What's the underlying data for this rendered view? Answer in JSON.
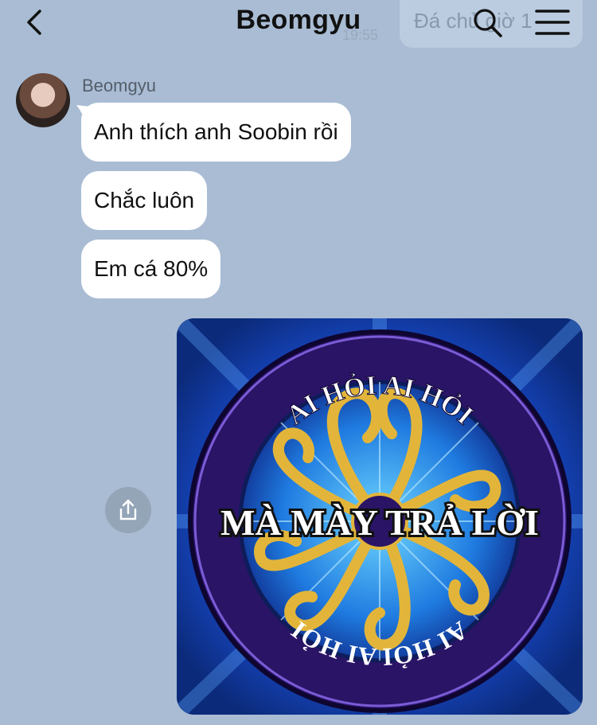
{
  "header": {
    "title": "Beomgyu",
    "pinned_preview": "Đá chủ giờ 1",
    "ghost_time": "19:55"
  },
  "chat": {
    "sender_name": "Beomgyu",
    "messages": [
      {
        "text": "Anh thích anh Soobin rồi"
      },
      {
        "text": "Chắc luôn"
      },
      {
        "text": "Em cá 80%"
      }
    ]
  },
  "meme": {
    "top_text": "AI HỎI AI HỎI",
    "main_text": "MÀ MÀY TRẢ LỜI",
    "bottom_text": "AI HỎI AI HỎI"
  },
  "colors": {
    "background": "#a9bcd4",
    "bubble": "#ffffff",
    "meme_blue": "#1a4fd6",
    "meme_gold": "#e2b53a",
    "meme_purple": "#2a1466"
  },
  "icons": [
    "back-icon",
    "search-icon",
    "menu-icon",
    "share-icon"
  ]
}
